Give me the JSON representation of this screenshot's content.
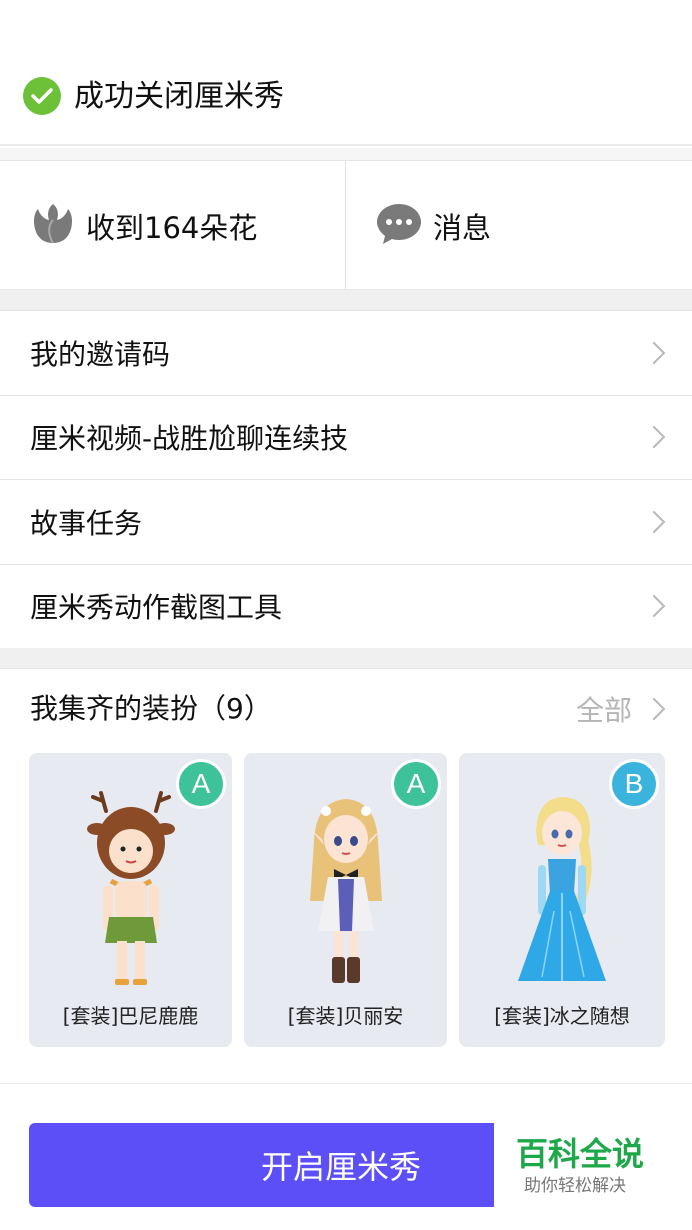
{
  "toast": {
    "icon": "check-circle-icon",
    "text": "成功关闭厘米秀"
  },
  "stats": [
    {
      "icon": "flower-icon",
      "label": "收到164朵花"
    },
    {
      "icon": "message-icon",
      "label": "消息"
    }
  ],
  "menu": [
    {
      "label": "我的邀请码"
    },
    {
      "label": "厘米视频-战胜尬聊连续技"
    },
    {
      "label": "故事任务"
    },
    {
      "label": "厘米秀动作截图工具"
    }
  ],
  "outfits": {
    "title": "我集齐的装扮（9）",
    "all_label": "全部",
    "items": [
      {
        "label": "[套装]巴尼鹿鹿",
        "badge": "A"
      },
      {
        "label": "[套装]贝丽安",
        "badge": "A"
      },
      {
        "label": "[套装]冰之随想",
        "badge": "B"
      }
    ]
  },
  "cta": {
    "label": "开启厘米秀"
  },
  "watermark": {
    "title": "百科全说",
    "subtitle": "助你轻松解决"
  },
  "colors": {
    "accent": "#5d4ff7",
    "success": "#6cc139",
    "badge_a": "#3dc29a",
    "badge_b": "#3ab4dc"
  }
}
